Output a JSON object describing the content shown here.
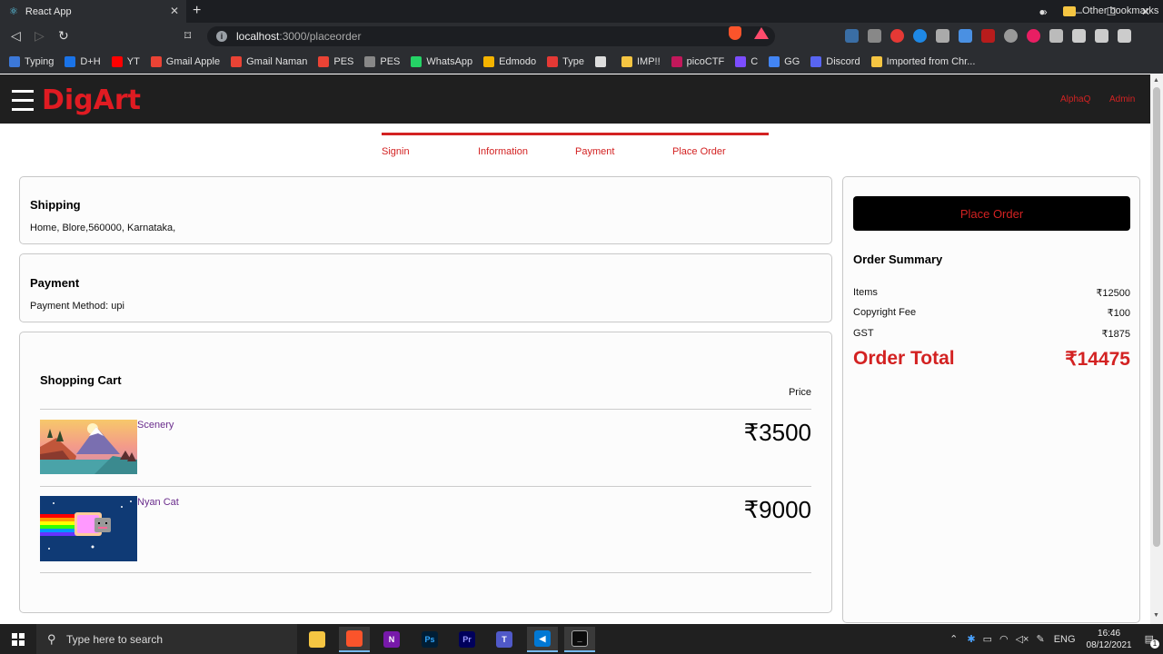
{
  "browser": {
    "tab_title": "React App",
    "url_host": "localhost",
    "url_path": ":3000/placeorder",
    "bookmarks": [
      {
        "label": "Typing",
        "color": "#3c78d8"
      },
      {
        "label": "D+H",
        "color": "#1a73e8"
      },
      {
        "label": "YT",
        "color": "#ff0000"
      },
      {
        "label": "Gmail Apple",
        "color": "#ea4335"
      },
      {
        "label": "Gmail Naman",
        "color": "#ea4335"
      },
      {
        "label": "PES",
        "color": "#ea4335"
      },
      {
        "label": "PES",
        "color": "#888888"
      },
      {
        "label": "WhatsApp",
        "color": "#25d366"
      },
      {
        "label": "Edmodo",
        "color": "#f5b400"
      },
      {
        "label": "Type",
        "color": "#e53935"
      },
      {
        "label": "",
        "color": "#dddddd"
      },
      {
        "label": "IMP!!",
        "color": "#f5c542"
      },
      {
        "label": "picoCTF",
        "color": "#c2185b"
      },
      {
        "label": "C",
        "color": "#7c4dff"
      },
      {
        "label": "GG",
        "color": "#4285f4"
      },
      {
        "label": "Discord",
        "color": "#5865f2"
      },
      {
        "label": "Imported from Chr...",
        "color": "#f5c542"
      }
    ],
    "bookmarks_more": "»",
    "other_bookmarks": "Other bookmarks"
  },
  "header": {
    "brand": "DigArt",
    "links": [
      "AlphaQ",
      "Admin"
    ]
  },
  "steps": [
    "Signin",
    "Information",
    "Payment",
    "Place Order"
  ],
  "shipping": {
    "title": "Shipping",
    "address": "Home, Blore,560000, Karnataka,"
  },
  "payment": {
    "title": "Payment",
    "method": "Payment Method: upi"
  },
  "cart": {
    "title": "Shopping Cart",
    "price_header": "Price",
    "items": [
      {
        "name": "Scenery",
        "price": "₹3500",
        "image_icon": "scenery-image"
      },
      {
        "name": "Nyan Cat",
        "price": "₹9000",
        "image_icon": "nyan-cat-image"
      }
    ]
  },
  "summary": {
    "button": "Place Order",
    "title": "Order Summary",
    "rows": [
      {
        "label": "Items",
        "value": "₹12500"
      },
      {
        "label": "Copyright Fee",
        "value": "₹100"
      },
      {
        "label": "GST",
        "value": "₹1875"
      }
    ],
    "total_label": "Order Total",
    "total_value": "₹14475"
  },
  "taskbar": {
    "search_placeholder": "Type here to search",
    "lang": "ENG",
    "time": "16:46",
    "date": "08/12/2021",
    "notif_count": "1"
  },
  "colors": {
    "accent": "#d32222",
    "header_bg": "#1f1f1f"
  }
}
